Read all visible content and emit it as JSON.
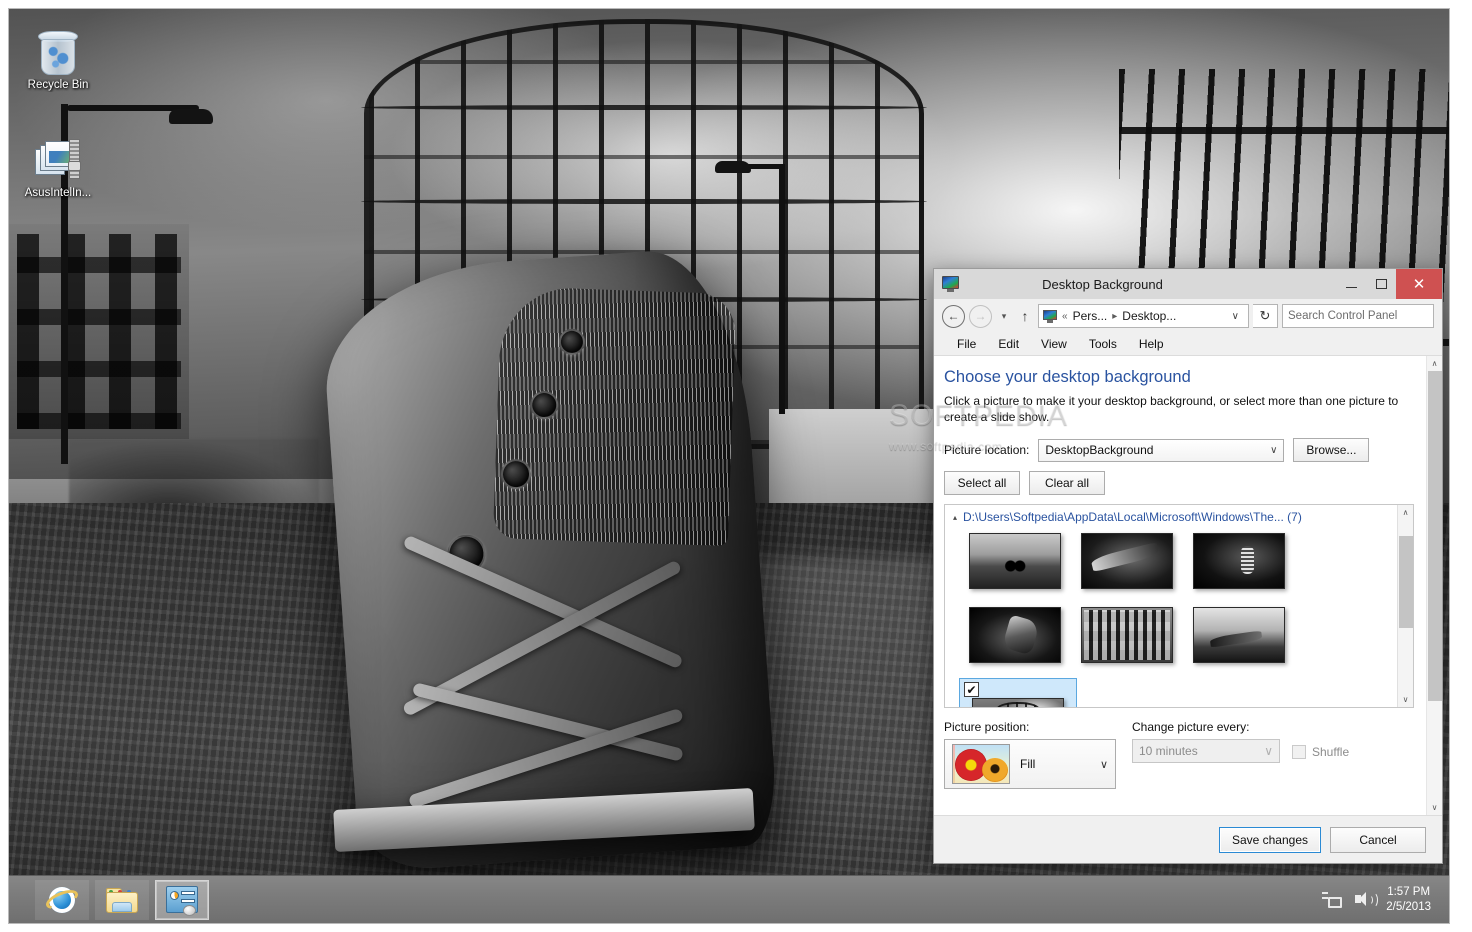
{
  "desktop": {
    "icons": [
      {
        "label": "Recycle Bin",
        "icon": "recycle-bin-icon"
      },
      {
        "label": "AsusIntelIn...",
        "icon": "zip-archive-icon"
      }
    ]
  },
  "taskbar": {
    "apps": [
      {
        "name": "internet-explorer",
        "label": "Internet Explorer",
        "active": false
      },
      {
        "name": "file-explorer",
        "label": "File Explorer",
        "active": false
      },
      {
        "name": "control-panel",
        "label": "Desktop Background",
        "active": true
      }
    ],
    "tray": {
      "network_label": "Network",
      "volume_label": "Speakers",
      "time": "1:57 PM",
      "date": "2/5/2013"
    }
  },
  "window": {
    "title": "Desktop Background",
    "controls": {
      "minimize": "–",
      "maximize": "□",
      "close": "✕"
    },
    "nav": {
      "back": "←",
      "forward": "→",
      "recent": "▾",
      "up": "↑",
      "refresh": "↻"
    },
    "breadcrumb": {
      "overflow": "«",
      "items": [
        "Pers...",
        "Desktop..."
      ],
      "separator": "▸",
      "dropdown": "∨"
    },
    "search": {
      "placeholder": "Search Control Panel",
      "value": "",
      "icon": "search-icon"
    },
    "menus": [
      "File",
      "Edit",
      "View",
      "Tools",
      "Help"
    ],
    "heading": "Choose your desktop background",
    "description": "Click a picture to make it your desktop background, or select more than one picture to create a slide show.",
    "picture_location": {
      "label": "Picture location:",
      "value": "DesktopBackground",
      "browse_label": "Browse..."
    },
    "selection_buttons": {
      "select_all": "Select all",
      "clear_all": "Clear all"
    },
    "gallery": {
      "group_label": "D:\\Users\\Softpedia\\AppData\\Local\\Microsoft\\Windows\\The... (7)",
      "group_expander": "▴",
      "thumbnails": [
        {
          "id": 1,
          "art": "t1",
          "selected": false
        },
        {
          "id": 2,
          "art": "t2",
          "selected": false
        },
        {
          "id": 3,
          "art": "t3",
          "selected": false
        },
        {
          "id": 4,
          "art": "t4",
          "selected": false
        },
        {
          "id": 5,
          "art": "t5",
          "selected": false
        },
        {
          "id": 6,
          "art": "t6",
          "selected": false
        },
        {
          "id": 7,
          "art": "t7",
          "selected": true
        }
      ],
      "checkmark": "✔"
    },
    "picture_position": {
      "label": "Picture position:",
      "value": "Fill",
      "carat": "∨"
    },
    "change_interval": {
      "label": "Change picture every:",
      "value": "10 minutes",
      "carat": "∨",
      "disabled": true
    },
    "shuffle": {
      "label": "Shuffle",
      "checked": false,
      "disabled": true
    },
    "actions": {
      "save": "Save changes",
      "cancel": "Cancel"
    },
    "scroll": {
      "up": "∧",
      "down": "∨"
    }
  },
  "watermark": {
    "title": "SOFTPEDIA",
    "url": "www.softpedia.com"
  },
  "colors": {
    "accent_blue": "#2a53a0",
    "selection_blue": "#cfe8fb",
    "selection_border": "#5ba8e0",
    "close_red": "#cf5151",
    "titlebar": "#d9d9d9",
    "chrome": "#f0f0f0"
  }
}
